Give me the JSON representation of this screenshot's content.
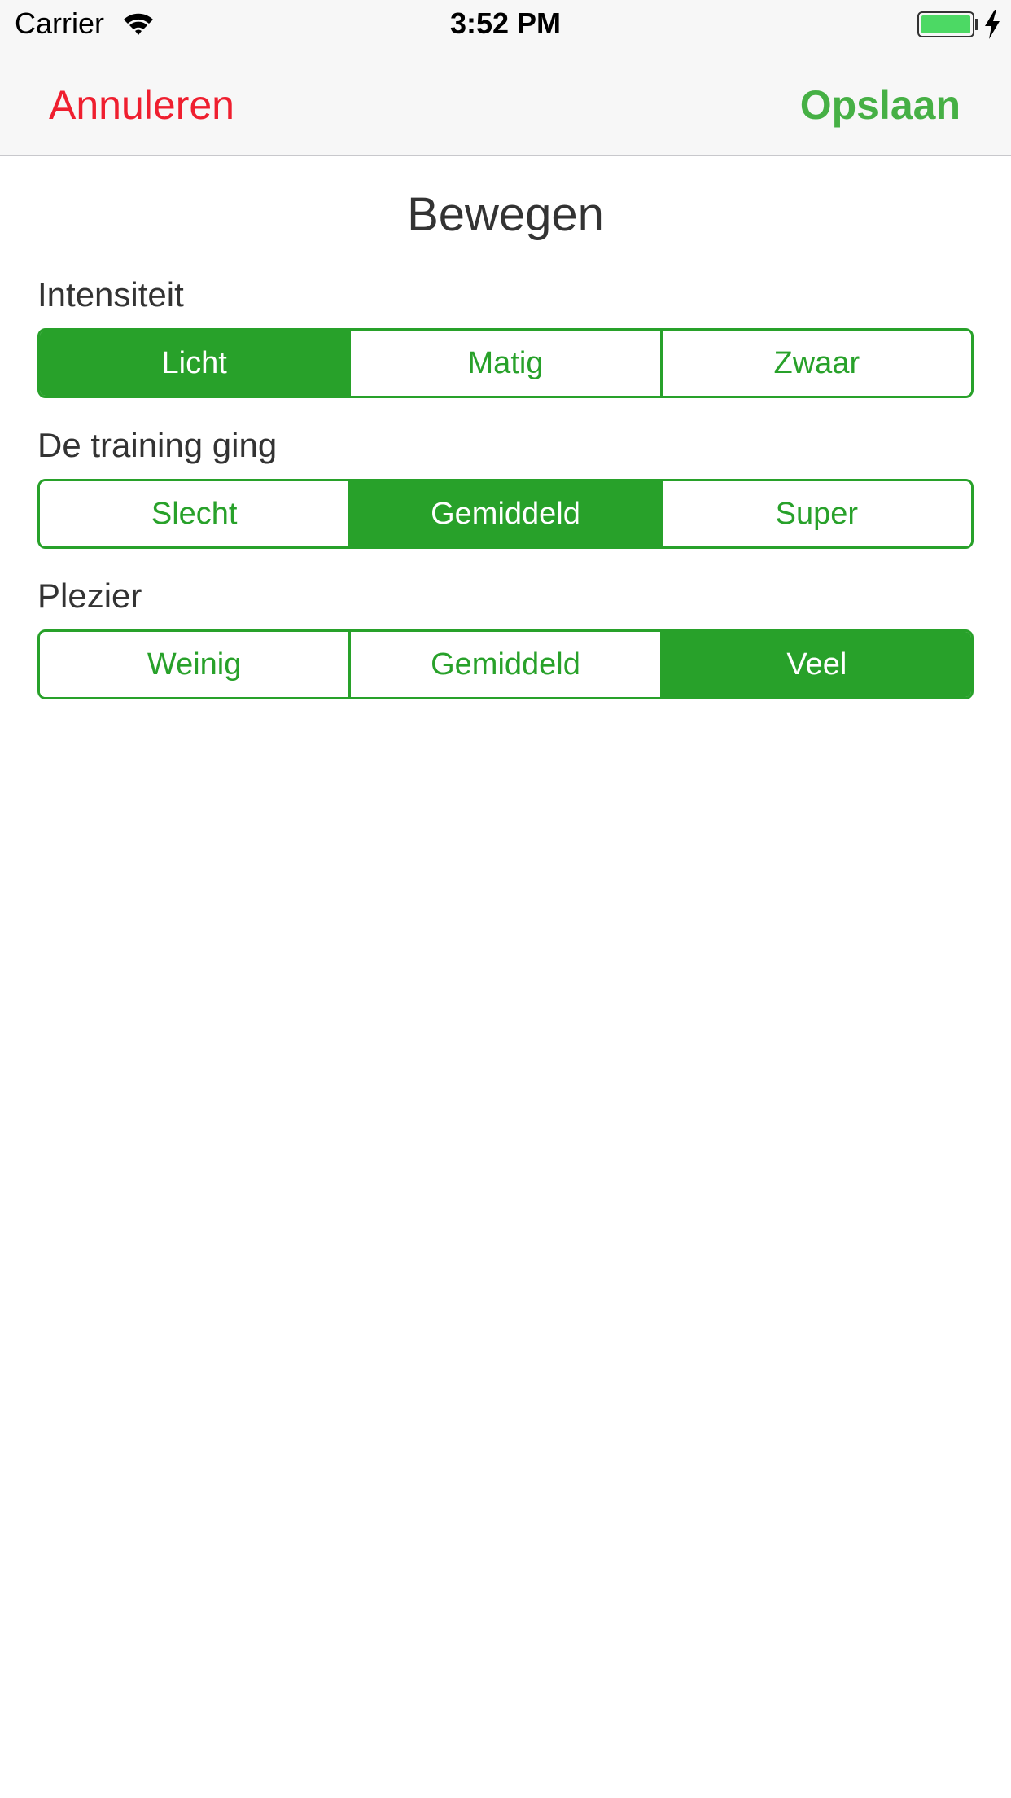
{
  "status_bar": {
    "carrier": "Carrier",
    "time": "3:52 PM",
    "battery_level": 1.0,
    "battery_color": "#4cd964",
    "icons": [
      "wifi-icon",
      "battery-icon",
      "charging-bolt-icon"
    ]
  },
  "nav": {
    "cancel_label": "Annuleren",
    "save_label": "Opslaan",
    "cancel_color": "#ef1f2f",
    "save_color": "#46b045"
  },
  "title": "Bewegen",
  "accent_color": "#28a12a",
  "sections": [
    {
      "label": "Intensiteit",
      "options": [
        "Licht",
        "Matig",
        "Zwaar"
      ],
      "selected_index": 0
    },
    {
      "label": "De training ging",
      "options": [
        "Slecht",
        "Gemiddeld",
        "Super"
      ],
      "selected_index": 1
    },
    {
      "label": "Plezier",
      "options": [
        "Weinig",
        "Gemiddeld",
        "Veel"
      ],
      "selected_index": 2
    }
  ]
}
